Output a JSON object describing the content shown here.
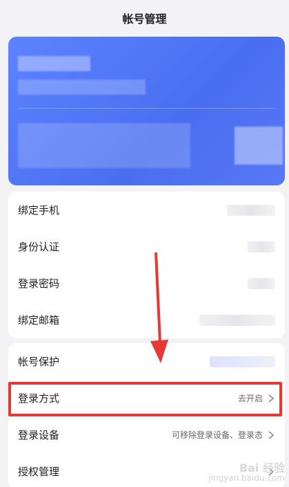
{
  "header": {
    "title": "帐号管理"
  },
  "groups": [
    {
      "rows": [
        {
          "label": "绑定手机"
        },
        {
          "label": "身份认证"
        },
        {
          "label": "登录密码"
        },
        {
          "label": "绑定邮箱"
        }
      ]
    },
    {
      "rows": [
        {
          "label": "帐号保护"
        },
        {
          "label": "登录方式",
          "value": "去开启"
        },
        {
          "label": "登录设备",
          "value": "可移除登录设备、登录态"
        },
        {
          "label": "授权管理"
        }
      ]
    }
  ],
  "colors": {
    "card_blue": "#4a6ef0",
    "highlight_red": "#e53935",
    "arrow_red": "#e53935"
  },
  "watermark": {
    "line1": "Bai 经验",
    "line2": "jingyan.baidu.com"
  }
}
